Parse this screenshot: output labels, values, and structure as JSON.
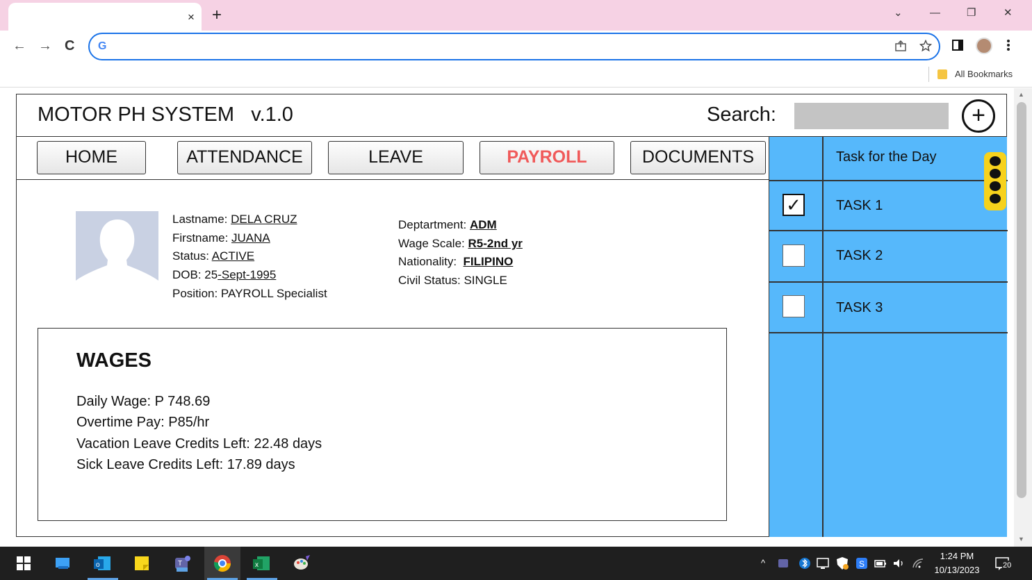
{
  "browser": {
    "tab_close": "×",
    "new_tab": "+",
    "controls": {
      "dropdown": "⌄",
      "minimize": "—",
      "restore": "❐",
      "close": "✕"
    },
    "nav": {
      "back": "←",
      "forward": "→",
      "reload": "C"
    },
    "omnibox_logo": "G",
    "bookmarks_label": "All Bookmarks"
  },
  "app": {
    "title": "MOTOR PH SYSTEM   v.1.0",
    "search_label": "Search:",
    "add_symbol": "+"
  },
  "nav": {
    "items": [
      {
        "label": "HOME",
        "active": false
      },
      {
        "label": "ATTENDANCE",
        "active": false
      },
      {
        "label": "LEAVE",
        "active": false
      },
      {
        "label": "PAYROLL",
        "active": true
      },
      {
        "label": "DOCUMENTS",
        "active": false
      }
    ],
    "active_color": "#f05a5a"
  },
  "profile": {
    "lastname_label": "Lastname: ",
    "lastname": "DELA CRUZ",
    "firstname_label": "Firstname: ",
    "firstname": "JUANA",
    "status_label": "Status: ",
    "status": "ACTIVE",
    "dob_label": "DOB: 25",
    "dob": "-Sept-1995",
    "position": "Position: PAYROLL Specialist",
    "department_label": "Deptartment: ",
    "department": "ADM",
    "wage_scale_label": "Wage Scale: ",
    "wage_scale": "R5-2nd yr",
    "nationality_label": "Nationality:  ",
    "nationality": "FILIPINO",
    "civil_status": "Civil Status: SINGLE"
  },
  "wages": {
    "title": "WAGES",
    "daily_wage": "Daily Wage: P 748.69",
    "overtime_pay": "Overtime Pay: P85/hr",
    "vacation_leave": "Vacation Leave Credits Left: 22.48 days",
    "sick_leave": "Sick Leave Credits Left: 17.89 days"
  },
  "tasks": {
    "header": "Task for the Day",
    "items": [
      {
        "label": "TASK 1",
        "checked": true,
        "mark": "✓"
      },
      {
        "label": "TASK 2",
        "checked": false,
        "mark": ""
      },
      {
        "label": "TASK 3",
        "checked": false,
        "mark": ""
      }
    ],
    "panel_color": "#56b8fb",
    "kebab_color": "#f7d21c"
  },
  "taskbar": {
    "time": "1:24 PM",
    "date": "10/13/2023",
    "notifications": "20"
  }
}
